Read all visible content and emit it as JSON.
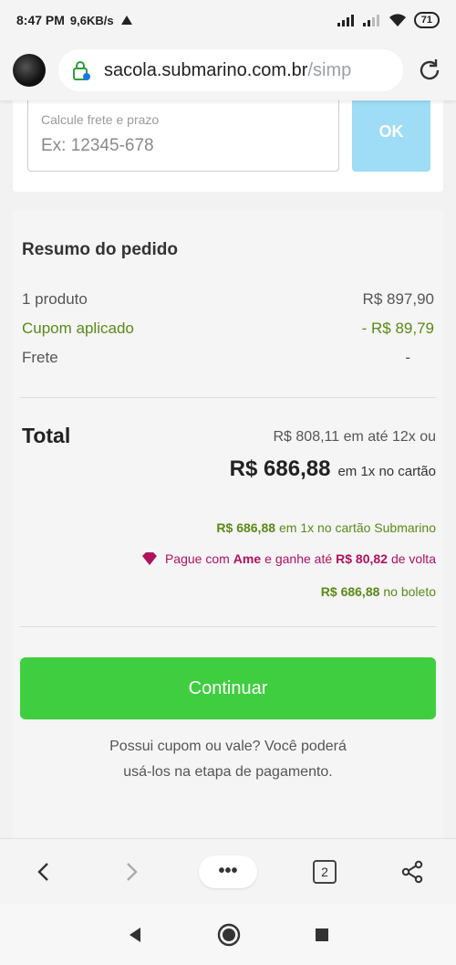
{
  "status_bar": {
    "time": "8:47 PM",
    "speed": "9,6KB/s",
    "battery": "71"
  },
  "browser": {
    "url_main": "sacola.submarino.com.br",
    "url_rest": "/simp"
  },
  "cep": {
    "label": "Calcule frete e prazo",
    "placeholder": "Ex: 12345-678",
    "ok_label": "OK"
  },
  "summary": {
    "title": "Resumo do pedido",
    "product_label": "1 produto",
    "product_value": "R$ 897,90",
    "coupon_label": "Cupom aplicado",
    "coupon_value": "- R$ 89,79",
    "shipping_label": "Frete",
    "shipping_value": "-",
    "total_label": "Total",
    "installment_text": "R$ 808,11 em até 12x ou",
    "total_value": "R$ 686,88",
    "total_suffix": "em 1x no cartão",
    "card_value": "R$ 686,88",
    "card_text": "em 1x no cartão Submarino",
    "ame_prefix": "Pague com",
    "ame_brand": "Ame",
    "ame_middle": "e ganhe até",
    "ame_value": "R$ 80,82",
    "ame_suffix": "de volta",
    "boleto_value": "R$ 686,88",
    "boleto_text": "no boleto",
    "continue_label": "Continuar",
    "note_line1": "Possui cupom ou vale? Você poderá",
    "note_line2": "usá-los na etapa de pagamento."
  },
  "toolbar": {
    "menu_label": "•••",
    "tab_count": "2"
  },
  "colors": {
    "accent_green": "#3fce3f",
    "price_green": "#5a8a18",
    "ame_pink": "#b0125e",
    "ok_blue": "#9fdcf5"
  }
}
